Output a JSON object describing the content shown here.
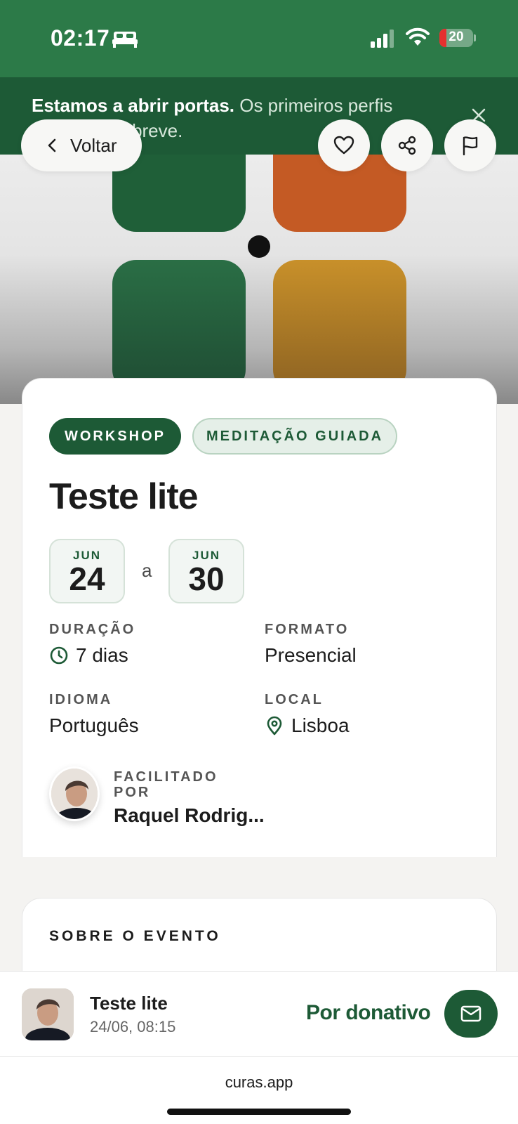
{
  "status": {
    "time": "02:17",
    "battery": "20"
  },
  "announcement": {
    "bold": "Estamos a abrir portas.",
    "rest": " Os primeiros perfis chegam em breve."
  },
  "nav": {
    "back_label": "Voltar"
  },
  "event": {
    "tags": [
      "WORKSHOP",
      "MEDITAÇÃO GUIADA"
    ],
    "title": "Teste lite",
    "start": {
      "month": "JUN",
      "day": "24"
    },
    "separator": "a",
    "end": {
      "month": "JUN",
      "day": "30"
    },
    "duration_label": "DURAÇÃO",
    "duration": "7 dias",
    "format_label": "FORMATO",
    "format": "Presencial",
    "language_label": "IDIOMA",
    "language": "Português",
    "location_label": "LOCAL",
    "location": "Lisboa",
    "facilitator_label": "FACILITADO POR",
    "facilitator": "Raquel Rodrig..."
  },
  "about": {
    "title": "SOBRE O EVENTO"
  },
  "bottom_bar": {
    "title": "Teste lite",
    "subtitle": "24/06, 08:15",
    "price": "Por donativo"
  },
  "browser": {
    "url": "curas.app"
  },
  "colors": {
    "brand_green": "#1d5a36",
    "status_green": "#2c7a48"
  }
}
